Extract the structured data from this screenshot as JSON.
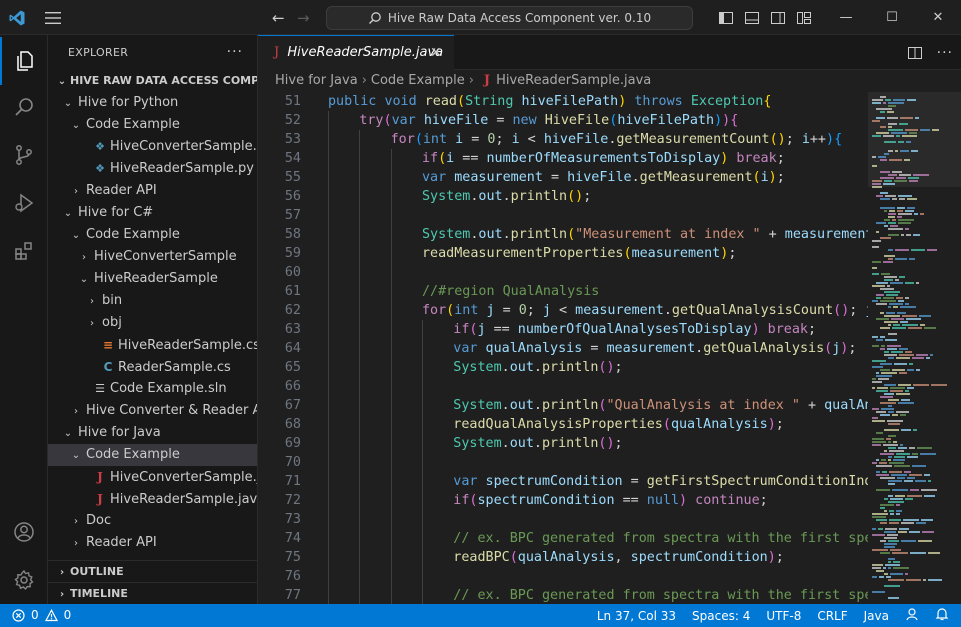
{
  "titlebar": {
    "search_text": "Hive Raw Data Access Component ver. 0.10",
    "back_icon": "arrow-left-icon",
    "forward_icon": "arrow-right-icon"
  },
  "sidebar": {
    "title": "EXPLORER",
    "more": "···",
    "root": "HIVE RAW DATA ACCESS COMPON...",
    "tree": [
      {
        "label": "Hive  for Python",
        "depth": 0,
        "type": "folder-open"
      },
      {
        "label": "Code Example",
        "depth": 1,
        "type": "folder-open"
      },
      {
        "label": "HiveConverterSample.py",
        "depth": 2,
        "type": "python"
      },
      {
        "label": "HiveReaderSample.py",
        "depth": 2,
        "type": "python"
      },
      {
        "label": "Reader API",
        "depth": 1,
        "type": "folder"
      },
      {
        "label": "Hive for C#",
        "depth": 0,
        "type": "folder-open"
      },
      {
        "label": "Code Example",
        "depth": 1,
        "type": "folder-open"
      },
      {
        "label": "HiveConverterSample",
        "depth": 2,
        "type": "folder"
      },
      {
        "label": "HiveReaderSample",
        "depth": 2,
        "type": "folder-open"
      },
      {
        "label": "bin",
        "depth": 3,
        "type": "folder"
      },
      {
        "label": "obj",
        "depth": 3,
        "type": "folder"
      },
      {
        "label": "HiveReaderSample.csproj",
        "depth": 3,
        "type": "csproj"
      },
      {
        "label": "ReaderSample.cs",
        "depth": 3,
        "type": "csharp"
      },
      {
        "label": "Code Example.sln",
        "depth": 2,
        "type": "sln"
      },
      {
        "label": "Hive Converter & Reader API",
        "depth": 1,
        "type": "folder"
      },
      {
        "label": "Hive for Java",
        "depth": 0,
        "type": "folder-open"
      },
      {
        "label": "Code Example",
        "depth": 1,
        "type": "folder-open",
        "selected": true
      },
      {
        "label": "HiveConverterSample.java",
        "depth": 2,
        "type": "java"
      },
      {
        "label": "HiveReaderSample.java",
        "depth": 2,
        "type": "java"
      },
      {
        "label": "Doc",
        "depth": 1,
        "type": "folder"
      },
      {
        "label": "Reader API",
        "depth": 1,
        "type": "folder"
      }
    ],
    "outline": "OUTLINE",
    "timeline": "TIMELINE"
  },
  "editor": {
    "tab_label": "HiveReaderSample.java",
    "breadcrumb": [
      "Hive for Java",
      "Code Example",
      "HiveReaderSample.java"
    ],
    "lines": [
      {
        "n": "51",
        "indent": 0,
        "code": [
          [
            "kw",
            "public "
          ],
          [
            "kw",
            "void "
          ],
          [
            "fn",
            "read"
          ],
          [
            "br1",
            "("
          ],
          [
            "cls",
            "String "
          ],
          [
            "var",
            "hiveFilePath"
          ],
          [
            "br1",
            ")"
          ],
          [
            "kw",
            " throws "
          ],
          [
            "cls",
            "Exception"
          ],
          [
            "br1",
            "{"
          ]
        ]
      },
      {
        "n": "52",
        "indent": 1,
        "code": [
          [
            "ctl",
            "try"
          ],
          [
            "br2",
            "("
          ],
          [
            "kw",
            "var "
          ],
          [
            "var",
            "hiveFile"
          ],
          [
            "pl",
            " = "
          ],
          [
            "kw",
            "new "
          ],
          [
            "fn",
            "HiveFile"
          ],
          [
            "br3",
            "("
          ],
          [
            "var",
            "hiveFilePath"
          ],
          [
            "br3",
            ")"
          ],
          [
            "br2",
            ")"
          ],
          [
            "br2",
            "{"
          ]
        ]
      },
      {
        "n": "53",
        "indent": 2,
        "code": [
          [
            "ctl",
            "for"
          ],
          [
            "br3",
            "("
          ],
          [
            "kw",
            "int "
          ],
          [
            "var",
            "i"
          ],
          [
            "pl",
            " = "
          ],
          [
            "num",
            "0"
          ],
          [
            "pl",
            "; "
          ],
          [
            "var",
            "i"
          ],
          [
            "pl",
            " < "
          ],
          [
            "var",
            "hiveFile"
          ],
          [
            "pl",
            "."
          ],
          [
            "fn",
            "getMeasurementCount"
          ],
          [
            "br1",
            "()"
          ],
          [
            "pl",
            "; "
          ],
          [
            "var",
            "i"
          ],
          [
            "pl",
            "++"
          ],
          [
            "br3",
            ")"
          ],
          [
            "br3",
            "{"
          ]
        ]
      },
      {
        "n": "54",
        "indent": 3,
        "code": [
          [
            "ctl",
            "if"
          ],
          [
            "br1",
            "("
          ],
          [
            "var",
            "i"
          ],
          [
            "pl",
            " == "
          ],
          [
            "var",
            "numberOfMeasurementsToDisplay"
          ],
          [
            "br1",
            ")"
          ],
          [
            "ctl",
            " break"
          ],
          [
            "pl",
            ";"
          ]
        ]
      },
      {
        "n": "55",
        "indent": 3,
        "code": [
          [
            "kw",
            "var "
          ],
          [
            "var",
            "measurement"
          ],
          [
            "pl",
            " = "
          ],
          [
            "var",
            "hiveFile"
          ],
          [
            "pl",
            "."
          ],
          [
            "fn",
            "getMeasurement"
          ],
          [
            "br1",
            "("
          ],
          [
            "var",
            "i"
          ],
          [
            "br1",
            ")"
          ],
          [
            "pl",
            ";"
          ]
        ]
      },
      {
        "n": "56",
        "indent": 3,
        "code": [
          [
            "cls",
            "System"
          ],
          [
            "pl",
            "."
          ],
          [
            "var",
            "out"
          ],
          [
            "pl",
            "."
          ],
          [
            "fn",
            "println"
          ],
          [
            "br1",
            "()"
          ],
          [
            "pl",
            ";"
          ]
        ]
      },
      {
        "n": "57",
        "indent": 3,
        "code": []
      },
      {
        "n": "58",
        "indent": 3,
        "code": [
          [
            "cls",
            "System"
          ],
          [
            "pl",
            "."
          ],
          [
            "var",
            "out"
          ],
          [
            "pl",
            "."
          ],
          [
            "fn",
            "println"
          ],
          [
            "br1",
            "("
          ],
          [
            "str",
            "\"Measurement at index \""
          ],
          [
            "pl",
            " + "
          ],
          [
            "var",
            "measurement"
          ],
          [
            "pl",
            ".g"
          ]
        ]
      },
      {
        "n": "59",
        "indent": 3,
        "code": [
          [
            "fn",
            "readMeasurementProperties"
          ],
          [
            "br1",
            "("
          ],
          [
            "var",
            "measurement"
          ],
          [
            "br1",
            ")"
          ],
          [
            "pl",
            ";"
          ]
        ]
      },
      {
        "n": "60",
        "indent": 3,
        "code": []
      },
      {
        "n": "61",
        "indent": 3,
        "code": [
          [
            "cmt",
            "//#region QualAnalysis"
          ]
        ]
      },
      {
        "n": "62",
        "indent": 3,
        "code": [
          [
            "ctl",
            "for"
          ],
          [
            "br1",
            "("
          ],
          [
            "kw",
            "int "
          ],
          [
            "var",
            "j"
          ],
          [
            "pl",
            " = "
          ],
          [
            "num",
            "0"
          ],
          [
            "pl",
            "; "
          ],
          [
            "var",
            "j"
          ],
          [
            "pl",
            " < "
          ],
          [
            "var",
            "measurement"
          ],
          [
            "pl",
            "."
          ],
          [
            "fn",
            "getQualAnalysisCount"
          ],
          [
            "br2",
            "()"
          ],
          [
            "pl",
            "; "
          ],
          [
            "var",
            "j"
          ],
          [
            "pl",
            "++"
          ]
        ]
      },
      {
        "n": "63",
        "indent": 4,
        "code": [
          [
            "ctl",
            "if"
          ],
          [
            "br2",
            "("
          ],
          [
            "var",
            "j"
          ],
          [
            "pl",
            " == "
          ],
          [
            "var",
            "numberOfQualAnalysesToDisplay"
          ],
          [
            "br2",
            ")"
          ],
          [
            "ctl",
            " break"
          ],
          [
            "pl",
            ";"
          ]
        ]
      },
      {
        "n": "64",
        "indent": 4,
        "code": [
          [
            "kw",
            "var "
          ],
          [
            "var",
            "qualAnalysis"
          ],
          [
            "pl",
            " = "
          ],
          [
            "var",
            "measurement"
          ],
          [
            "pl",
            "."
          ],
          [
            "fn",
            "getQualAnalysis"
          ],
          [
            "br2",
            "("
          ],
          [
            "var",
            "j"
          ],
          [
            "br2",
            ")"
          ],
          [
            "pl",
            ";"
          ]
        ]
      },
      {
        "n": "65",
        "indent": 4,
        "code": [
          [
            "cls",
            "System"
          ],
          [
            "pl",
            "."
          ],
          [
            "var",
            "out"
          ],
          [
            "pl",
            "."
          ],
          [
            "fn",
            "println"
          ],
          [
            "br2",
            "()"
          ],
          [
            "pl",
            ";"
          ]
        ]
      },
      {
        "n": "66",
        "indent": 4,
        "code": []
      },
      {
        "n": "67",
        "indent": 4,
        "code": [
          [
            "cls",
            "System"
          ],
          [
            "pl",
            "."
          ],
          [
            "var",
            "out"
          ],
          [
            "pl",
            "."
          ],
          [
            "fn",
            "println"
          ],
          [
            "br2",
            "("
          ],
          [
            "str",
            "\"QualAnalysis at index \""
          ],
          [
            "pl",
            " + "
          ],
          [
            "var",
            "qualAnal"
          ]
        ]
      },
      {
        "n": "68",
        "indent": 4,
        "code": [
          [
            "fn",
            "readQualAnalysisProperties"
          ],
          [
            "br2",
            "("
          ],
          [
            "var",
            "qualAnalysis"
          ],
          [
            "br2",
            ")"
          ],
          [
            "pl",
            ";"
          ]
        ]
      },
      {
        "n": "69",
        "indent": 4,
        "code": [
          [
            "cls",
            "System"
          ],
          [
            "pl",
            "."
          ],
          [
            "var",
            "out"
          ],
          [
            "pl",
            "."
          ],
          [
            "fn",
            "println"
          ],
          [
            "br2",
            "()"
          ],
          [
            "pl",
            ";"
          ]
        ]
      },
      {
        "n": "70",
        "indent": 4,
        "code": []
      },
      {
        "n": "71",
        "indent": 4,
        "code": [
          [
            "kw",
            "var "
          ],
          [
            "var",
            "spectrumCondition"
          ],
          [
            "pl",
            " = "
          ],
          [
            "fn",
            "getFirstSpectrumConditionIndic"
          ]
        ]
      },
      {
        "n": "72",
        "indent": 4,
        "code": [
          [
            "ctl",
            "if"
          ],
          [
            "br2",
            "("
          ],
          [
            "var",
            "spectrumCondition"
          ],
          [
            "pl",
            " == "
          ],
          [
            "kw",
            "null"
          ],
          [
            "br2",
            ")"
          ],
          [
            "ctl",
            " continue"
          ],
          [
            "pl",
            ";"
          ]
        ]
      },
      {
        "n": "73",
        "indent": 4,
        "code": []
      },
      {
        "n": "74",
        "indent": 4,
        "code": [
          [
            "cmt",
            "// ex. BPC generated from spectra with the first spect"
          ]
        ]
      },
      {
        "n": "75",
        "indent": 4,
        "code": [
          [
            "fn",
            "readBPC"
          ],
          [
            "br2",
            "("
          ],
          [
            "var",
            "qualAnalysis"
          ],
          [
            "pl",
            ", "
          ],
          [
            "var",
            "spectrumCondition"
          ],
          [
            "br2",
            ")"
          ],
          [
            "pl",
            ";"
          ]
        ]
      },
      {
        "n": "76",
        "indent": 4,
        "code": []
      },
      {
        "n": "77",
        "indent": 4,
        "code": [
          [
            "cmt",
            "// ex. BPC generated from spectra with the first spect"
          ]
        ]
      }
    ]
  },
  "statusbar": {
    "errors": "0",
    "warnings": "0",
    "position": "Ln 37, Col 33",
    "spaces": "Spaces: 4",
    "encoding": "UTF-8",
    "eol": "CRLF",
    "language": "Java"
  }
}
